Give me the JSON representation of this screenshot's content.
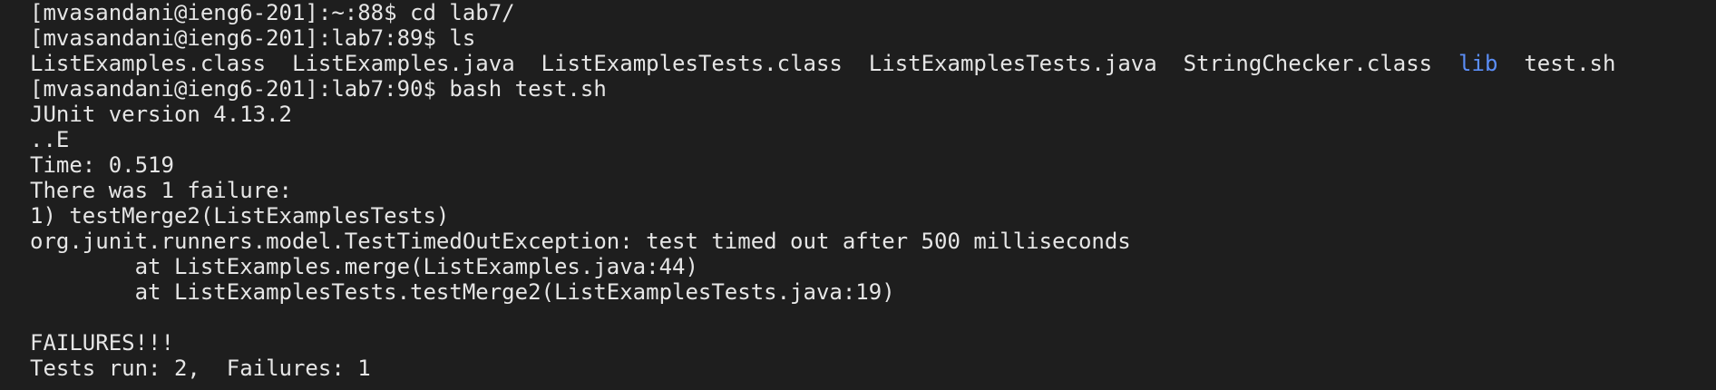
{
  "terminal": {
    "lines": [
      "[mvasandani@ieng6-201]:~:88$ cd lab7/",
      "[mvasandani@ieng6-201]:lab7:89$ ls",
      "",
      "[mvasandani@ieng6-201]:lab7:90$ bash test.sh",
      "JUnit version 4.13.2",
      "..E",
      "Time: 0.519",
      "There was 1 failure:",
      "1) testMerge2(ListExamplesTests)",
      "org.junit.runners.model.TestTimedOutException: test timed out after 500 milliseconds",
      "        at ListExamples.merge(ListExamples.java:44)",
      "        at ListExamplesTests.testMerge2(ListExamplesTests.java:19)",
      "",
      "FAILURES!!!",
      "Tests run: 2,  Failures: 1"
    ],
    "ls_output": {
      "item0": "ListExamples.class",
      "item1": "ListExamples.java",
      "item2": "ListExamplesTests.class",
      "item3": "ListExamplesTests.java",
      "item4": "StringChecker.class",
      "item5": "lib",
      "item6": "test.sh"
    },
    "colors": {
      "background": "#1e1e1e",
      "text": "#e6e6e6",
      "directory": "#5b8ef7"
    }
  }
}
